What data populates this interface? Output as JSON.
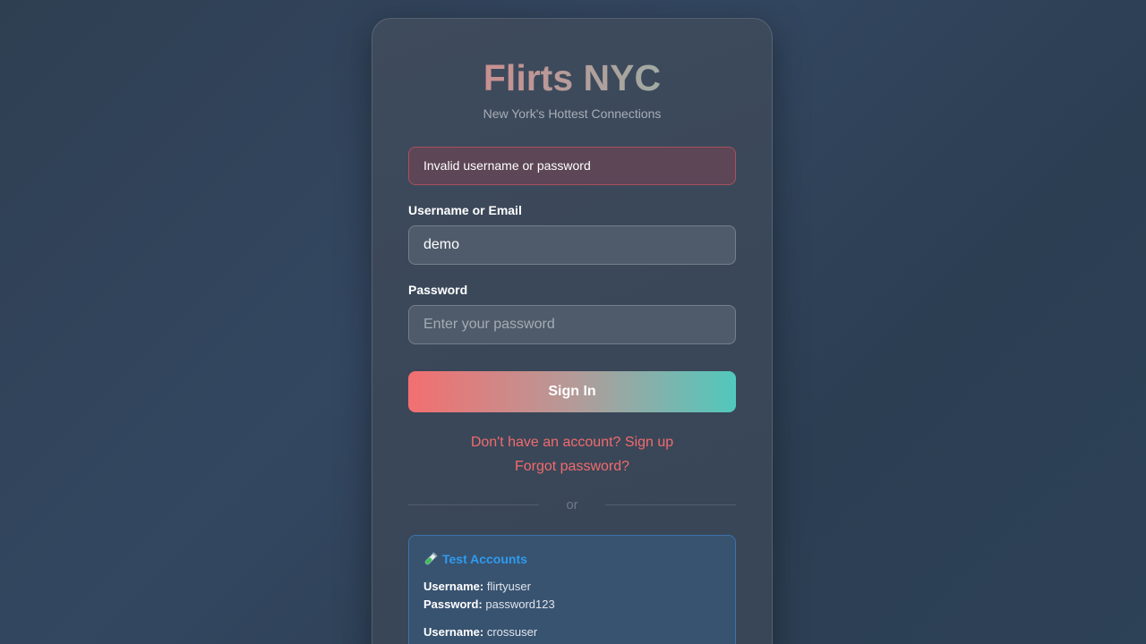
{
  "app": {
    "title": "Flirts NYC",
    "subtitle": "New York's Hottest Connections"
  },
  "error": {
    "message": "Invalid username or password"
  },
  "form": {
    "username_label": "Username or Email",
    "username_value": "demo",
    "password_label": "Password",
    "password_placeholder": "Enter your password",
    "submit_label": "Sign In"
  },
  "links": {
    "signup": "Don't have an account? Sign up",
    "forgot": "Forgot password?"
  },
  "divider": {
    "text": "or"
  },
  "test_accounts": {
    "title": "Test Accounts",
    "icon": "test-tube-icon",
    "username_key": "Username:",
    "password_key": "Password:",
    "accounts": [
      {
        "username": "flirtyuser",
        "password": "password123"
      },
      {
        "username": "crossuser"
      }
    ]
  },
  "colors": {
    "accent_red": "#f26b6d",
    "accent_teal": "#52c8bd",
    "info_blue": "#2f9bf0"
  }
}
